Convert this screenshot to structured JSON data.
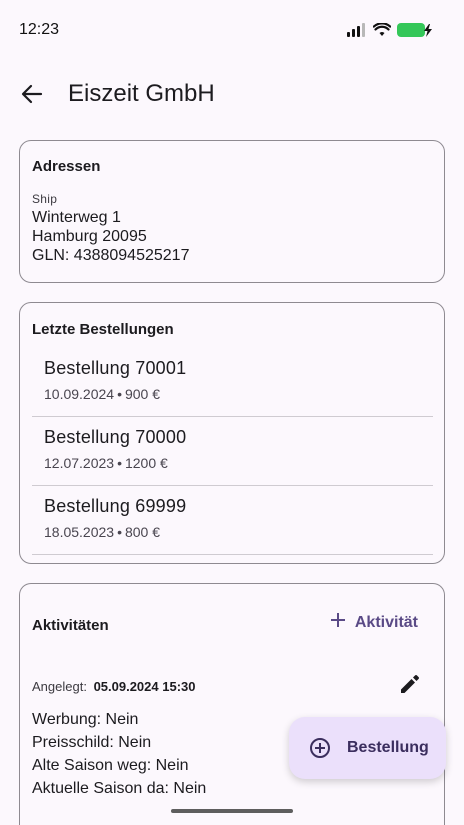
{
  "status_bar": {
    "time": "12:23"
  },
  "header": {
    "title": "Eiszeit GmbH"
  },
  "addresses": {
    "title": "Adressen",
    "type": "Ship",
    "line1": "Winterweg 1",
    "line2": "Hamburg 20095",
    "line3": "GLN: 4388094525217"
  },
  "orders": {
    "title": "Letzte Bestellungen",
    "items": [
      {
        "title": "Bestellung 70001",
        "date": "10.09.2024",
        "amount": "900 €"
      },
      {
        "title": "Bestellung 70000",
        "date": "12.07.2023",
        "amount": "1200 €"
      },
      {
        "title": "Bestellung 69999",
        "date": "18.05.2023",
        "amount": "800 €"
      }
    ],
    "separator": "•"
  },
  "activities": {
    "title": "Aktivitäten",
    "add_label": "Aktivität",
    "created_label": "Angelegt:",
    "created_value": "05.09.2024 15:30",
    "lines": [
      "Werbung: Nein",
      "Preisschild: Nein",
      "Alte Saison weg: Nein",
      "Aktuelle Saison da: Nein"
    ]
  },
  "fab": {
    "label": "Bestellung"
  },
  "colors": {
    "background": "#fcf8fd",
    "accent": "#5a4a86",
    "fab_background": "#ebe0fb",
    "battery": "#34c759"
  },
  "icons": {
    "back": "arrow-back-icon",
    "add": "plus-icon",
    "edit": "pencil-icon",
    "fab": "add-circle-icon"
  }
}
